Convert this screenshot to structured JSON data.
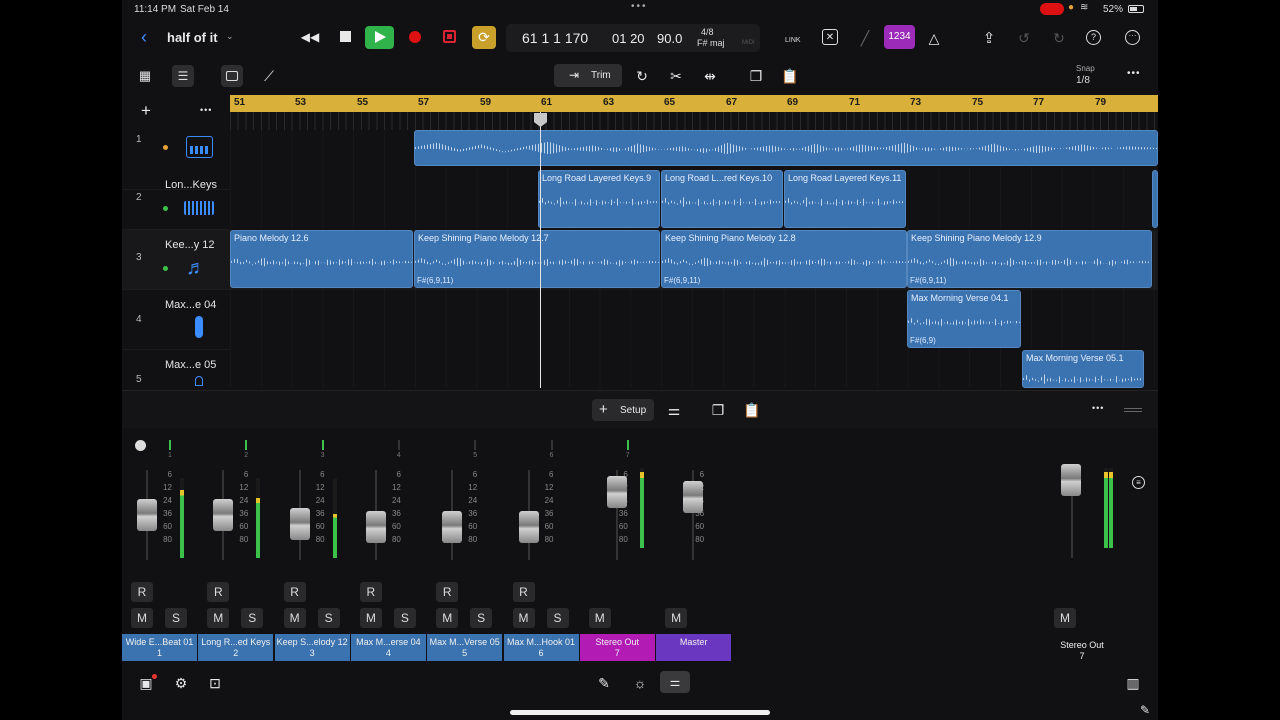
{
  "status": {
    "time": "11:14 PM",
    "date": "Sat Feb 14",
    "battery": "52%"
  },
  "project": {
    "title": "half of it"
  },
  "transport": {
    "position": "61 1 1 170",
    "time": "01 20",
    "tempo": "90.0",
    "signature": "4/8",
    "key": "F# maj",
    "midi": "MIDI",
    "link": "LINK",
    "badge": "1234"
  },
  "toolbar": {
    "trim_label": "Trim",
    "snap_label": "Snap",
    "snap_value": "1/8"
  },
  "ruler": {
    "bars": [
      "51",
      "53",
      "55",
      "57",
      "59",
      "61",
      "63",
      "65",
      "67",
      "69",
      "71",
      "73",
      "75",
      "77",
      "79"
    ]
  },
  "tracks": [
    {
      "num": "1",
      "name": "",
      "dot": "#e8a23a"
    },
    {
      "num": "2",
      "name": "Lon...Keys",
      "dot": "#3cc24a"
    },
    {
      "num": "3",
      "name": "Kee...y 12",
      "dot": "#3cc24a"
    },
    {
      "num": "4",
      "name": "Max...e 04",
      "dot": ""
    },
    {
      "num": "5",
      "name": "Max...e 05",
      "dot": ""
    }
  ],
  "regions": [
    {
      "name": "Long Road Layered Keys.9",
      "chord": ""
    },
    {
      "name": "Long Road L...red Keys.10",
      "chord": ""
    },
    {
      "name": "Long Road Layered Keys.11",
      "chord": ""
    },
    {
      "name": "Piano Melody 12.6",
      "chord": ""
    },
    {
      "name": "Keep Shining Piano Melody 12.7",
      "chord": "F#(6,9,11)"
    },
    {
      "name": "Keep Shining Piano Melody 12.8",
      "chord": "F#(6,9,11)"
    },
    {
      "name": "Keep Shining Piano Melody 12.9",
      "chord": "F#(6,9,11)"
    },
    {
      "name": "Max Morning Verse 04.1",
      "chord": "F#(6,9)"
    },
    {
      "name": "Max Morning Verse 05.1",
      "chord": ""
    }
  ],
  "mixer_bar": {
    "setup_label": "Setup"
  },
  "mixer": {
    "channel_numbers": [
      "1",
      "2",
      "3",
      "4",
      "5",
      "6",
      "7"
    ],
    "scale": [
      "6",
      "12",
      "24",
      "36",
      "60",
      "80"
    ],
    "r_label": "R",
    "m_label": "M",
    "s_label": "S",
    "channels": [
      {
        "name": "Wide E...Beat 01",
        "num": "1",
        "color": "#3a73b0",
        "fader": 0.62,
        "meter": 0.85
      },
      {
        "name": "Long R...ed Keys",
        "num": "2",
        "color": "#3a73b0",
        "fader": 0.62,
        "meter": 0.75
      },
      {
        "name": "Keep S...elody 12",
        "num": "3",
        "color": "#3a73b0",
        "fader": 0.5,
        "meter": 0.55
      },
      {
        "name": "Max M...erse 04",
        "num": "4",
        "color": "#3a73b0",
        "fader": 0.45,
        "meter": 0
      },
      {
        "name": "Max M...Verse 05",
        "num": "5",
        "color": "#3a73b0",
        "fader": 0.45,
        "meter": 0
      },
      {
        "name": "Max M...Hook 01",
        "num": "6",
        "color": "#3a73b0",
        "fader": 0.45,
        "meter": 0
      },
      {
        "name": "Stereo Out",
        "num": "7",
        "color": "#b21cb5",
        "fader": 0.92,
        "meter": 0.95
      },
      {
        "name": "Master",
        "num": "",
        "color": "#6a38c0",
        "fader": 0.85,
        "meter": 0
      }
    ],
    "right_channel": {
      "name": "Stereo Out",
      "num": "7",
      "meter": 0.95
    }
  }
}
